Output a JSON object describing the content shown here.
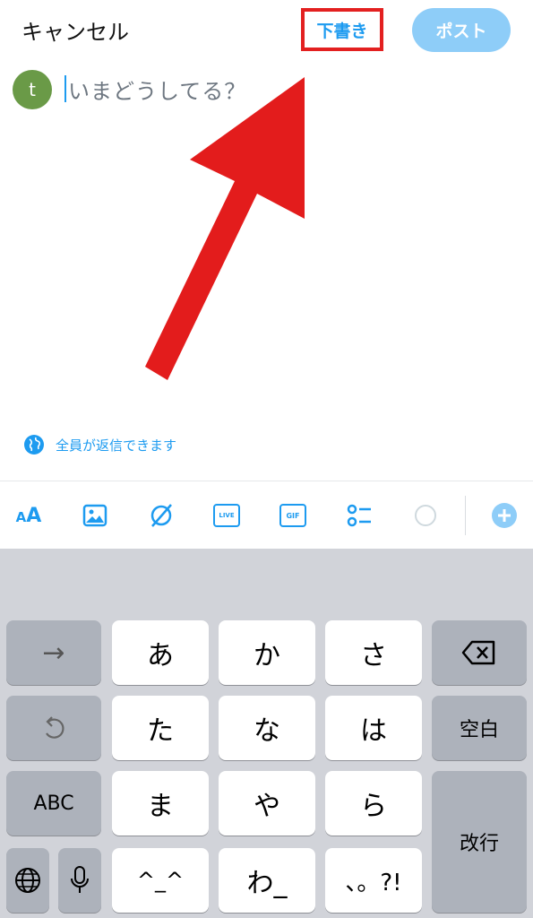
{
  "header": {
    "cancel_label": "キャンセル",
    "drafts_label": "下書き",
    "post_label": "ポスト"
  },
  "compose": {
    "avatar_initial": "t",
    "placeholder": "いまどうしてる？"
  },
  "reply_setting": {
    "label": "全員が返信できます"
  },
  "toolbar": {
    "text_size_label": "AA",
    "live_label": "LIVE",
    "gif_label": "GIF"
  },
  "keyboard": {
    "row1": [
      "→",
      "あ",
      "か",
      "さ"
    ],
    "row2": [
      "た",
      "な",
      "は",
      "空白"
    ],
    "row3": [
      "ABC",
      "ま",
      "や",
      "ら",
      "改行"
    ],
    "row4": [
      "^_^",
      "わ_",
      "、。?!"
    ]
  },
  "colors": {
    "accent": "#1d9bf0",
    "highlight": "#e32020",
    "post_disabled": "#8ecdf8",
    "avatar": "#6a9a47"
  }
}
